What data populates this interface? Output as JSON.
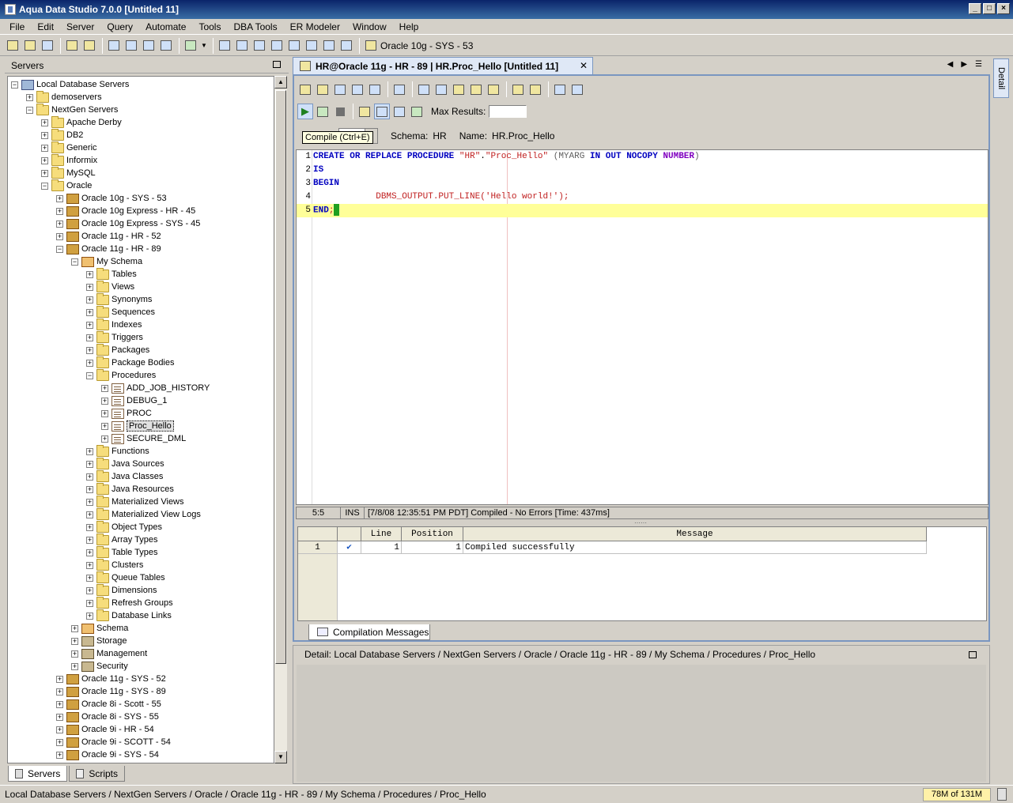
{
  "window": {
    "title": "Aqua Data Studio 7.0.0 [Untitled 11]"
  },
  "menu": [
    "File",
    "Edit",
    "Server",
    "Query",
    "Automate",
    "Tools",
    "DBA Tools",
    "ER Modeler",
    "Window",
    "Help"
  ],
  "toolbar": {
    "active_server": "Oracle 10g - SYS - 53"
  },
  "left_panel": {
    "title": "Servers",
    "tabs": [
      "Servers",
      "Scripts"
    ],
    "tree": [
      {
        "label": "Local Database Servers",
        "icon": "computer-icon",
        "expander": "−"
      },
      {
        "label": "demoservers",
        "icon": "folder-icon",
        "expander": "+"
      },
      {
        "label": "NextGen Servers",
        "icon": "folder-icon",
        "expander": "−"
      },
      {
        "label": "Apache Derby",
        "icon": "folder-icon",
        "expander": "+"
      },
      {
        "label": "DB2",
        "icon": "folder-icon",
        "expander": "+"
      },
      {
        "label": "Generic",
        "icon": "folder-icon",
        "expander": "+"
      },
      {
        "label": "Informix",
        "icon": "folder-icon",
        "expander": "+"
      },
      {
        "label": "MySQL",
        "icon": "folder-icon",
        "expander": "+"
      },
      {
        "label": "Oracle",
        "icon": "folder-icon",
        "expander": "−"
      },
      {
        "label": "Oracle 10g - SYS - 53",
        "icon": "server-icon",
        "expander": "+"
      },
      {
        "label": "Oracle 10g Express - HR - 45",
        "icon": "server-icon",
        "expander": "+"
      },
      {
        "label": "Oracle 10g Express - SYS - 45",
        "icon": "server-icon",
        "expander": "+"
      },
      {
        "label": "Oracle 11g - HR - 52",
        "icon": "server-icon",
        "expander": "+"
      },
      {
        "label": "Oracle 11g - HR - 89",
        "icon": "server-icon",
        "expander": "−"
      },
      {
        "label": "My Schema",
        "icon": "schema-icon",
        "expander": "−"
      },
      {
        "label": "Tables",
        "icon": "folder-icon",
        "expander": "+"
      },
      {
        "label": "Views",
        "icon": "folder-icon",
        "expander": "+"
      },
      {
        "label": "Synonyms",
        "icon": "folder-icon",
        "expander": "+"
      },
      {
        "label": "Sequences",
        "icon": "folder-icon",
        "expander": "+"
      },
      {
        "label": "Indexes",
        "icon": "folder-icon",
        "expander": "+"
      },
      {
        "label": "Triggers",
        "icon": "folder-icon",
        "expander": "+"
      },
      {
        "label": "Packages",
        "icon": "folder-icon",
        "expander": "+"
      },
      {
        "label": "Package Bodies",
        "icon": "folder-icon",
        "expander": "+"
      },
      {
        "label": "Procedures",
        "icon": "folder-icon",
        "expander": "−"
      },
      {
        "label": "ADD_JOB_HISTORY",
        "icon": "procedure-icon",
        "expander": "+"
      },
      {
        "label": "DEBUG_1",
        "icon": "procedure-icon",
        "expander": "+"
      },
      {
        "label": "PROC",
        "icon": "procedure-icon",
        "expander": "+"
      },
      {
        "label": "Proc_Hello",
        "icon": "procedure-icon",
        "expander": "+",
        "selected": true
      },
      {
        "label": "SECURE_DML",
        "icon": "procedure-icon",
        "expander": "+"
      },
      {
        "label": "Functions",
        "icon": "folder-icon",
        "expander": "+"
      },
      {
        "label": "Java Sources",
        "icon": "folder-icon",
        "expander": "+"
      },
      {
        "label": "Java Classes",
        "icon": "folder-icon",
        "expander": "+"
      },
      {
        "label": "Java Resources",
        "icon": "folder-icon",
        "expander": "+"
      },
      {
        "label": "Materialized Views",
        "icon": "folder-icon",
        "expander": "+"
      },
      {
        "label": "Materialized View Logs",
        "icon": "folder-icon",
        "expander": "+"
      },
      {
        "label": "Object Types",
        "icon": "folder-icon",
        "expander": "+"
      },
      {
        "label": "Array Types",
        "icon": "folder-icon",
        "expander": "+"
      },
      {
        "label": "Table Types",
        "icon": "folder-icon",
        "expander": "+"
      },
      {
        "label": "Clusters",
        "icon": "folder-icon",
        "expander": "+"
      },
      {
        "label": "Queue Tables",
        "icon": "folder-icon",
        "expander": "+"
      },
      {
        "label": "Dimensions",
        "icon": "folder-icon",
        "expander": "+"
      },
      {
        "label": "Refresh Groups",
        "icon": "folder-icon",
        "expander": "+"
      },
      {
        "label": "Database Links",
        "icon": "folder-icon",
        "expander": "+"
      },
      {
        "label": "Schema",
        "icon": "schema-icon",
        "expander": "+"
      },
      {
        "label": "Storage",
        "icon": "storage-icon",
        "expander": "+"
      },
      {
        "label": "Management",
        "icon": "management-icon",
        "expander": "+"
      },
      {
        "label": "Security",
        "icon": "security-icon",
        "expander": "+"
      },
      {
        "label": "Oracle 11g - SYS - 52",
        "icon": "server-icon",
        "expander": "+"
      },
      {
        "label": "Oracle 11g - SYS - 89",
        "icon": "server-icon",
        "expander": "+"
      },
      {
        "label": "Oracle 8i - Scott - 55",
        "icon": "server-icon",
        "expander": "+"
      },
      {
        "label": "Oracle 8i - SYS - 55",
        "icon": "server-icon",
        "expander": "+"
      },
      {
        "label": "Oracle 9i - HR - 54",
        "icon": "server-icon",
        "expander": "+"
      },
      {
        "label": "Oracle 9i - SCOTT - 54",
        "icon": "server-icon",
        "expander": "+"
      },
      {
        "label": "Oracle 9i - SYS - 54",
        "icon": "server-icon",
        "expander": "+"
      }
    ]
  },
  "editor": {
    "tab_title": "HR@Oracle 11g - HR - 89 | HR.Proc_Hello [Untitled 11]",
    "max_results_label": "Max Results:",
    "max_results_value": "",
    "tooltip": "Compile (Ctrl+E)",
    "schema_label": "Schema:",
    "schema_value": "HR",
    "name_label": "Name:",
    "name_value": "HR.Proc_Hello",
    "code_lines": [
      "CREATE OR REPLACE PROCEDURE \"HR\".\"Proc_Hello\" (MYARG IN OUT NOCOPY NUMBER)",
      "IS",
      "BEGIN",
      "            DBMS_OUTPUT.PUT_LINE('Hello world!');",
      "END;"
    ],
    "line_numbers": [
      "1",
      "2",
      "3",
      "4",
      "5"
    ],
    "status": {
      "position": "5:5",
      "mode": "INS",
      "message": "[7/8/08 12:35:51 PM PDT] Compiled - No Errors [Time: 437ms]"
    }
  },
  "results": {
    "columns": [
      "Line",
      "Position",
      "Message"
    ],
    "rows": [
      {
        "row": "1",
        "line": "1",
        "position": "1",
        "message": "Compiled successfully"
      }
    ],
    "tab": "Compilation Messages"
  },
  "detail": {
    "breadcrumb": "Detail: Local Database Servers / NextGen Servers / Oracle / Oracle 11g - HR - 89 / My Schema / Procedures / Proc_Hello"
  },
  "side_tab": "Detail",
  "statusbar": {
    "path": "Local Database Servers / NextGen Servers / Oracle / Oracle 11g - HR - 89 / My Schema / Procedures / Proc_Hello",
    "memory": "78M of 131M"
  }
}
